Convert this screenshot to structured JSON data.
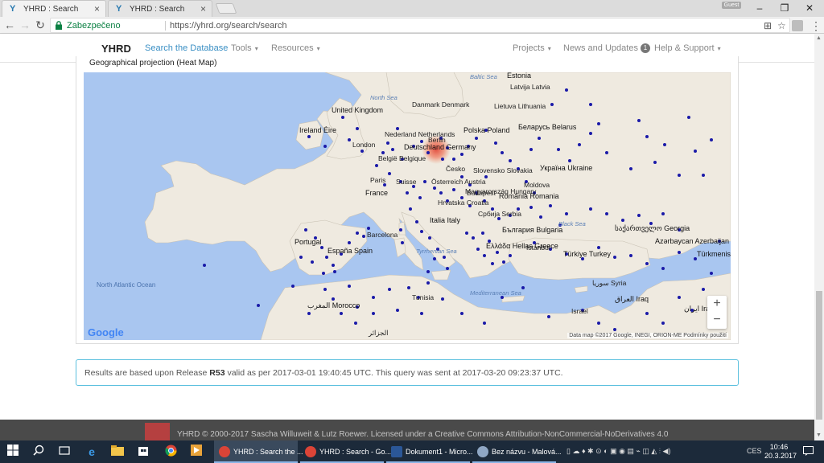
{
  "browser": {
    "tabs": [
      {
        "favicon": "Y",
        "title": "YHRD : Search",
        "close": "×"
      },
      {
        "favicon": "Y",
        "title": "YHRD : Search",
        "close": "×"
      }
    ],
    "guest_label": "Guest",
    "window_controls": {
      "minimize": "–",
      "restore": "❐",
      "close": "✕"
    },
    "nav": {
      "back": "←",
      "forward": "→",
      "reload": "↻"
    },
    "secure_label": "Zabezpečeno",
    "url": "https://yhrd.org/search/search",
    "omnibox_icons": {
      "translate": "⊞",
      "star": "☆"
    },
    "menu_icon": "⋮"
  },
  "site_nav": {
    "logo": "YHRD",
    "links": [
      {
        "label": "Search the Database",
        "active": true
      },
      {
        "label": "Tools",
        "caret": "▾"
      },
      {
        "label": "Resources",
        "caret": "▾"
      },
      {
        "label": "Projects",
        "caret": "▾"
      },
      {
        "label": "News and Updates",
        "badge": "1"
      },
      {
        "label": "Help & Support",
        "caret": "▾"
      }
    ]
  },
  "map_panel": {
    "title": "Geographical projection (Heat Map)",
    "labels": {
      "countries": [
        "United Kingdom",
        "Ireland Éire",
        "Nederland Netherlands",
        "België Belgique",
        "Deutschland Germany",
        "Polska Poland",
        "Беларусь Belarus",
        "Україна Ukraine",
        "France",
        "Suisse",
        "Österreich Austria",
        "Česko",
        "Slovensko Slovakia",
        "Magyarország Hungary",
        "Hrvatska Croatia",
        "Србија Serbia",
        "România Romania",
        "Moldova",
        "България Bulgaria",
        "Italia Italy",
        "España Spain",
        "Portugal",
        "Ελλάδα Hellas Greece",
        "Türkiye Turkey",
        "საქართველო Georgia",
        "Azərbaycan Azerbaijan",
        "Türkmenistan",
        "سوريا Syria",
        "العراق Iraq",
        "ایران Iran",
        "Israel",
        "المغرب Morocco",
        "Tunisia",
        "الجزائر",
        "Danmark Denmark",
        "Latvija Latvia",
        "Lietuva Lithuania",
        "Estonia"
      ],
      "cities": [
        "London",
        "Paris",
        "Berlin",
        "Barcelona",
        "Budapest",
        "Istanbul"
      ],
      "seas": [
        "North Sea",
        "Baltic Sea",
        "Black Sea",
        "Tyrrhenian Sea",
        "Mediterranean Sea"
      ],
      "ocean": "North Atlantic Ocean"
    },
    "google_logo": "Google",
    "attribution": "Data map ©2017 Google, INEGI, ORION-ME     Podmínky použití",
    "zoom_in": "+",
    "zoom_out": "−",
    "colors": {
      "water": "#a9c6f0",
      "land": "#efeae0",
      "marker": "#1a1aa8",
      "heat": "#e0483a"
    }
  },
  "result": {
    "prefix": "Results are based upon Release ",
    "release": "R53",
    "suffix": " valid as per 2017-03-01 19:40:45 UTC. This query was sent at 2017-03-20 09:23:37 UTC."
  },
  "footer": {
    "text": "YHRD © 2000-2017 Sascha Willuweit & Lutz Roewer. Licensed under a Creative Commons Attribution-NonCommercial-NoDerivatives 4.0"
  },
  "taskbar": {
    "icons": [
      "windows-start",
      "search",
      "task-view",
      "edge",
      "file-explorer",
      "store",
      "chrome",
      "media"
    ],
    "apps": [
      {
        "label": "YHRD : Search the ...",
        "active": true
      },
      {
        "label": "YHRD : Search - Go...",
        "active": false
      },
      {
        "label": "Dokument1 - Micro...",
        "active": false
      },
      {
        "label": "Bez názvu - Malová...",
        "active": false
      }
    ],
    "language": "CES",
    "time": "10:46",
    "date": "20.3.2017"
  }
}
